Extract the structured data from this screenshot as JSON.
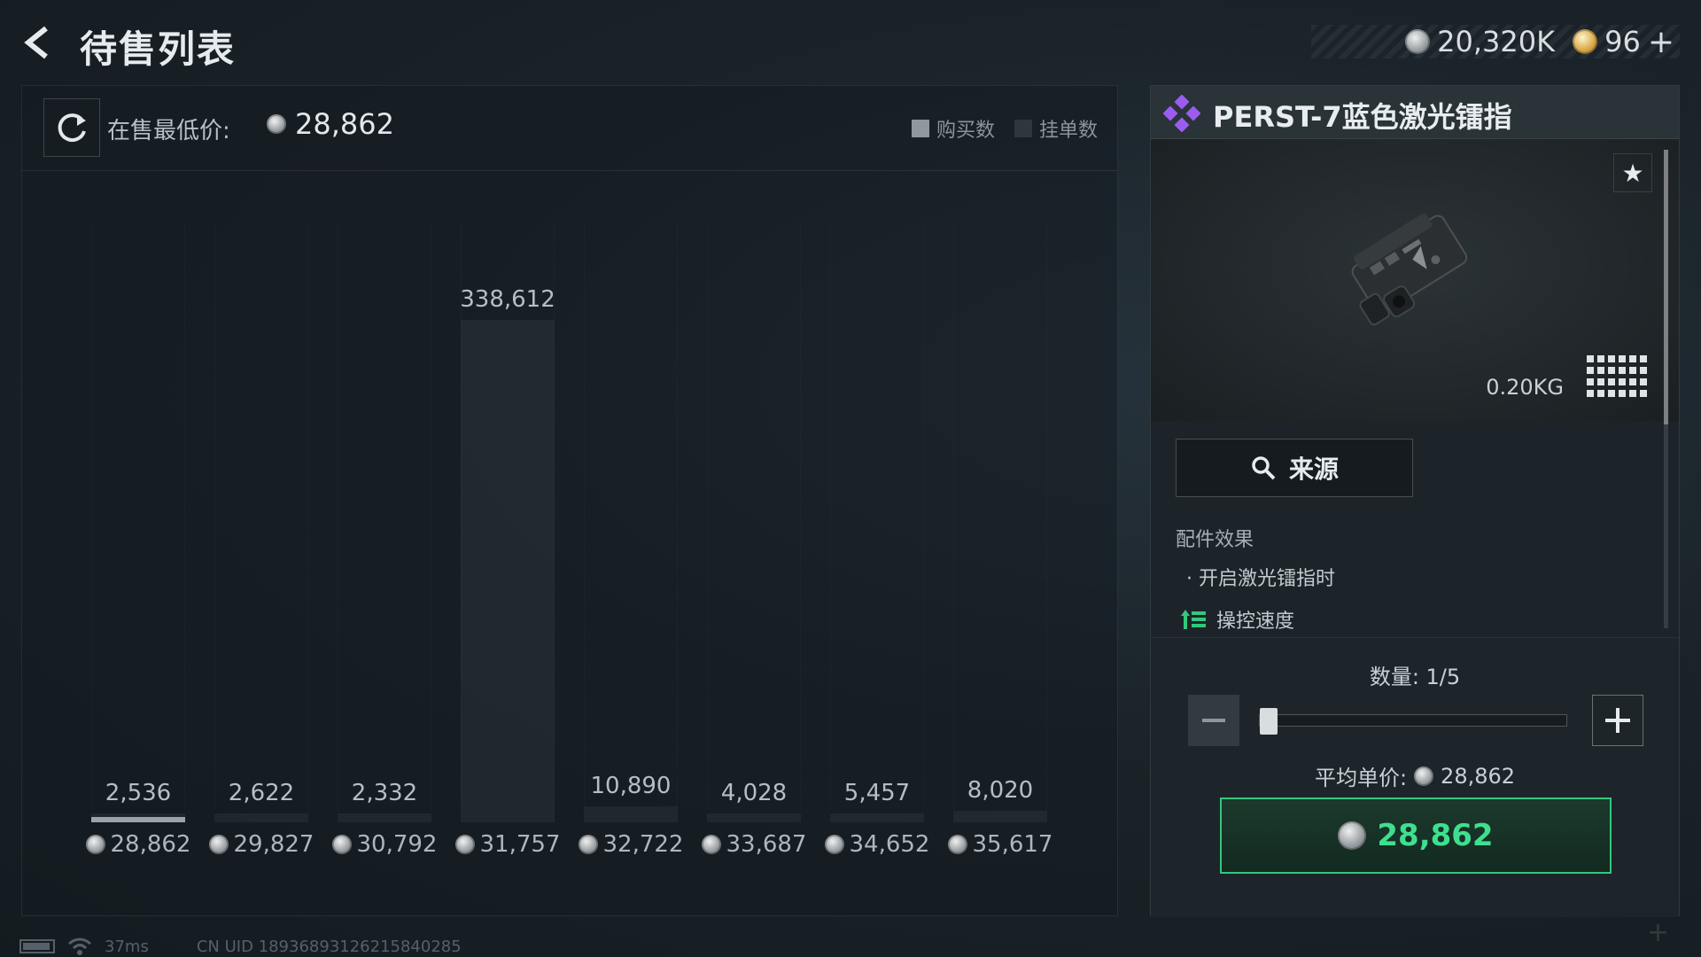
{
  "header": {
    "title": "待售列表",
    "back_icon": "chevron-left-icon",
    "silver_balance": "20,320K",
    "gold_balance": "96",
    "gold_plus": "+"
  },
  "summary": {
    "lowest_label": "在售最低价:",
    "lowest_price": "28,862"
  },
  "legend": {
    "buy": "购买数",
    "listing": "挂单数",
    "buy_color": "#8f989d",
    "listing_color": "#2e373c"
  },
  "chart_data": {
    "type": "bar",
    "categories": [
      "28,862",
      "29,827",
      "30,792",
      "31,757",
      "32,722",
      "33,687",
      "34,652",
      "35,617"
    ],
    "series": [
      {
        "name": "挂单数",
        "values": [
          2536,
          2622,
          2332,
          338612,
          10890,
          4028,
          5457,
          8020
        ]
      }
    ],
    "value_labels": [
      "2,536",
      "2,622",
      "2,332",
      "338,612",
      "10,890",
      "4,028",
      "5,457",
      "8,020"
    ],
    "highlighted_index": 0,
    "xlabel": "",
    "ylabel": ""
  },
  "item": {
    "name": "PERST-7蓝色激光镭指",
    "weight": "0.20KG",
    "source_label": "来源",
    "effects_title": "配件效果",
    "effect_line": "· 开启激光镭指时",
    "effect_stat": "操控速度",
    "accent": "#9b5cf0"
  },
  "purchase": {
    "quantity_label": "数量: 1/5",
    "quantity_fraction": 0.2,
    "avg_label": "平均单价:",
    "avg_price": "28,862",
    "total_price": "28,862",
    "button_color": "#33c77e"
  },
  "footer": {
    "ping": "37ms",
    "uid": "CN UID 18936893126215840285"
  }
}
